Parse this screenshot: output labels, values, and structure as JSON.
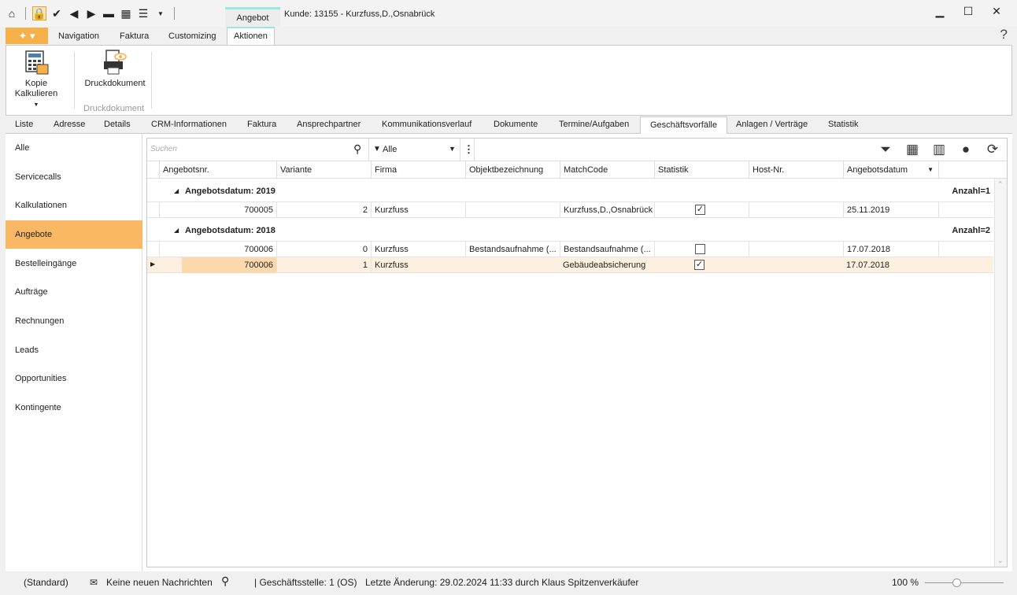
{
  "window": {
    "context_tab": "Angebot",
    "title": "Kunde: 13155 - Kurzfuss,D.,Osnabrück",
    "help": "?"
  },
  "menu": {
    "navigation": "Navigation",
    "faktura": "Faktura",
    "customizing": "Customizing",
    "aktionen": "Aktionen"
  },
  "ribbon": {
    "kopie_line1": "Kopie",
    "kopie_line2": "Kalkulieren",
    "druck": "Druckdokument",
    "group_label": "Druckdokument"
  },
  "tabs": [
    "Liste",
    "Adresse",
    "Details",
    "CRM-Informationen",
    "Faktura",
    "Ansprechpartner",
    "Kommunikationsverlauf",
    "Dokumente",
    "Termine/Aufgaben",
    "Geschäftsvorfälle",
    "Anlagen / Verträge",
    "Statistik"
  ],
  "sidebar": [
    "Alle",
    "Servicecalls",
    "Kalkulationen",
    "Angebote",
    "Bestelleingänge",
    "Aufträge",
    "Rechnungen",
    "Leads",
    "Opportunities",
    "Kontingente"
  ],
  "grid": {
    "search_placeholder": "Suchen",
    "filter_value": "Alle",
    "columns": [
      "Angebotsnr.",
      "Variante",
      "Firma",
      "Objektbezeichnung",
      "MatchCode",
      "Statistik",
      "Host-Nr.",
      "Angebotsdatum"
    ],
    "groups": [
      {
        "label": "Angebotsdatum: 2019",
        "count": "Anzahl=1",
        "rows": [
          {
            "nr": "700005",
            "variante": "2",
            "firma": "Kurzfuss",
            "objekt": "",
            "match": "Kurzfuss,D.,Osnabrück",
            "statistik": true,
            "host": "",
            "datum": "25.11.2019"
          }
        ]
      },
      {
        "label": "Angebotsdatum: 2018",
        "count": "Anzahl=2",
        "rows": [
          {
            "nr": "700006",
            "variante": "0",
            "firma": "Kurzfuss",
            "objekt": "Bestandsaufnahme (...",
            "match": "Bestandsaufnahme (...",
            "statistik": false,
            "host": "",
            "datum": "17.07.2018"
          },
          {
            "nr": "700006",
            "variante": "1",
            "firma": "Kurzfuss",
            "objekt": "",
            "match": "Gebäudeabsicherung",
            "statistik": true,
            "host": "",
            "datum": "17.07.2018"
          }
        ]
      }
    ]
  },
  "status": {
    "layout": "(Standard)",
    "messages": "Keine neuen Nachrichten",
    "branch": "| Geschäftsstelle:  1 (OS)",
    "last_change": "Letzte Änderung: 29.02.2024 11:33 durch Klaus Spitzenverkäufer",
    "zoom": "100 %"
  },
  "colors": {
    "accent": "#f5b049",
    "selected_sidebar": "#fbb864",
    "context_tab_bar": "#9de6e0"
  }
}
